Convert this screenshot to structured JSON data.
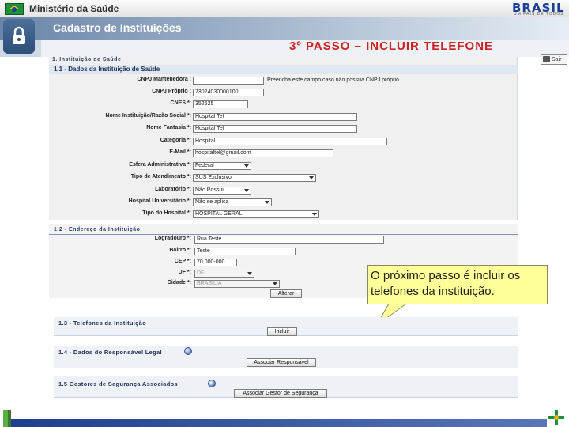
{
  "topbar": {
    "ministry": "Ministério da Saúde",
    "brand": "BRASIL",
    "brand_tagline": "UM PAÍS DE TODOS"
  },
  "header": {
    "title": "Cadastro de Instituições",
    "step_title": "3º PASSO – INCLUIR TELEFONE",
    "exit_label": "Sair"
  },
  "section1": {
    "heading": "1. Instituição de Saúde",
    "sub_heading": "1.1 - Dados da Instituição de Saúde",
    "fields": [
      {
        "label": "CNPJ Mantenedora :",
        "value": "",
        "type": "input"
      },
      {
        "label": "CNPJ Próprio :",
        "value": "73024030000100",
        "type": "input"
      },
      {
        "label": "CNES *:",
        "value": "352525",
        "type": "input"
      },
      {
        "label": "Nome Instituição/Razão Social *:",
        "value": "Hospital Tel",
        "type": "input"
      },
      {
        "label": "Nome Fantasia *:",
        "value": "Hospital Tel",
        "type": "input"
      },
      {
        "label": "Categoria *:",
        "value": "Hospital",
        "type": "input"
      },
      {
        "label": "E-Mail *:",
        "value": "hospitaltel@gmail.com",
        "type": "input"
      },
      {
        "label": "Esfera Administrativa *:",
        "value": "Federal",
        "type": "select"
      },
      {
        "label": "Tipo de Atendimento *:",
        "value": "SUS Exclusivo",
        "type": "select"
      },
      {
        "label": "Laboratório *:",
        "value": "Não Possui",
        "type": "select"
      },
      {
        "label": "Hospital Universitário *:",
        "value": "Não se aplica",
        "type": "select"
      },
      {
        "label": "Tipo do Hospital *:",
        "value": "HOSPITAL GERAL",
        "type": "select"
      }
    ],
    "cnpj_hint": "Preencha este campo caso não possua CNPJ próprio."
  },
  "section12": {
    "heading": "1.2 - Endereço da Instituição",
    "fields": [
      {
        "label": "Logradouro *:",
        "value": "Rua Teste"
      },
      {
        "label": "Bairro *:",
        "value": "Teste"
      },
      {
        "label": "CEP *:",
        "value": "70.000-000"
      },
      {
        "label": "UF *:",
        "value": "DF"
      },
      {
        "label": "Cidade *:",
        "value": "BRASÍLIA"
      }
    ],
    "change_button": "Alterar"
  },
  "callout": {
    "text": "O próximo passo é incluir os telefones da instituição."
  },
  "section13": {
    "heading": "1.3 - Telefones da Instituição",
    "button": "Incluir"
  },
  "section14": {
    "heading": "1.4 - Dados do Responsável Legal",
    "button": "Associar Responsável"
  },
  "section15": {
    "heading": "1.5  Gestores de Segurança Associados",
    "button": "Associar Gestor de Segurança"
  },
  "colors": {
    "step_title": "#cc2222",
    "header_blue": "#6a85a8",
    "callout_bg": "#ffff99",
    "footer_blue": "#1d3f8f"
  }
}
